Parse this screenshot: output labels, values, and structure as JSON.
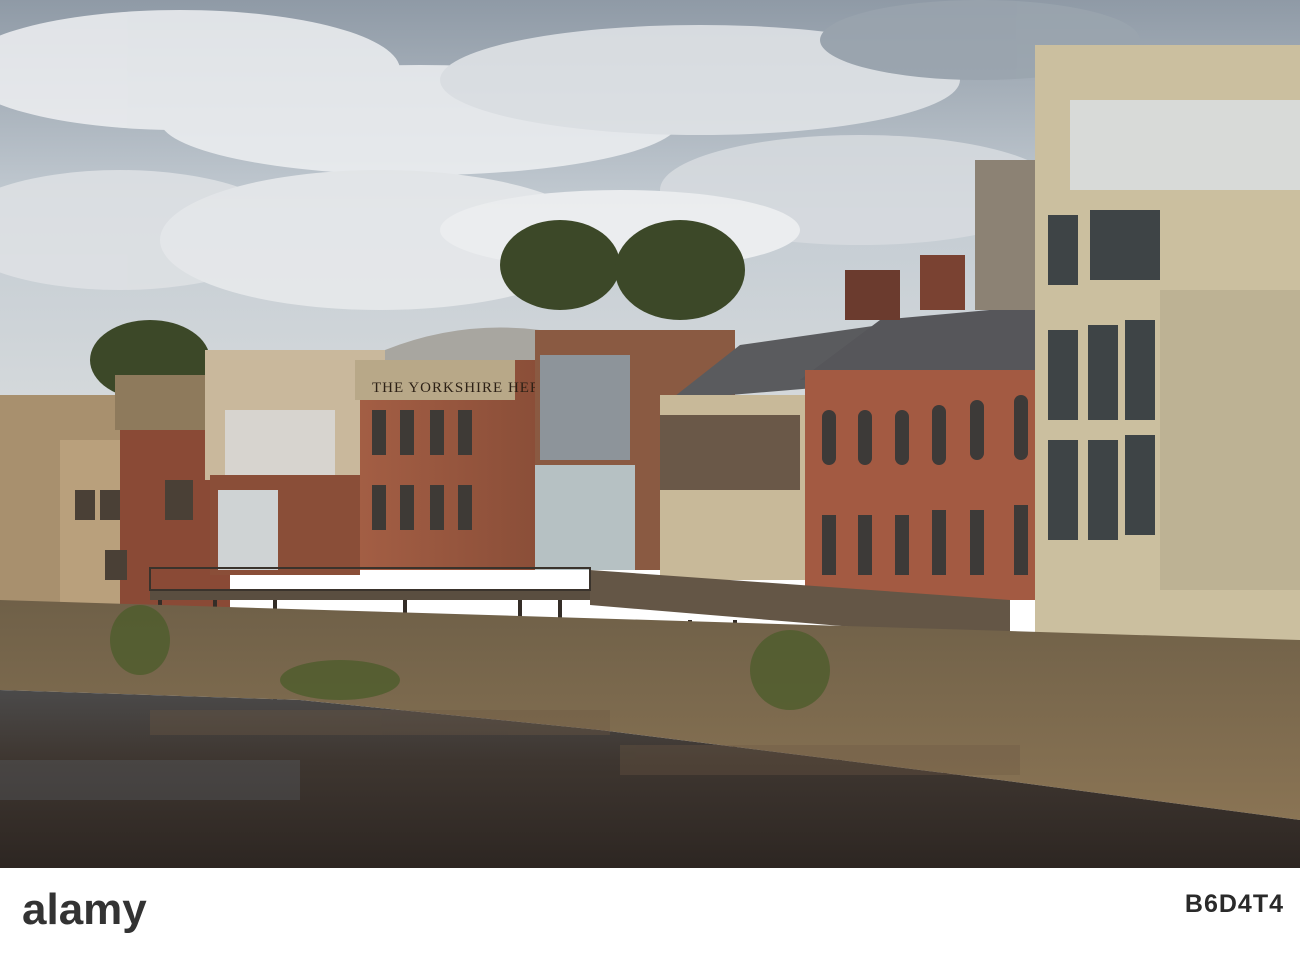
{
  "scene": {
    "building_sign": "THE YORKSHIRE HERALD",
    "colors": {
      "sky": "#b9c3cd",
      "cloud": "#eef0f2",
      "river": "#3a3430",
      "brick": "#8a4a34",
      "stone": "#b79a78",
      "concrete": "#cbbf9f",
      "tree": "#3d4a2a"
    }
  },
  "watermark": {
    "logo_text": "alamy",
    "image_id": "B6D4T4"
  }
}
